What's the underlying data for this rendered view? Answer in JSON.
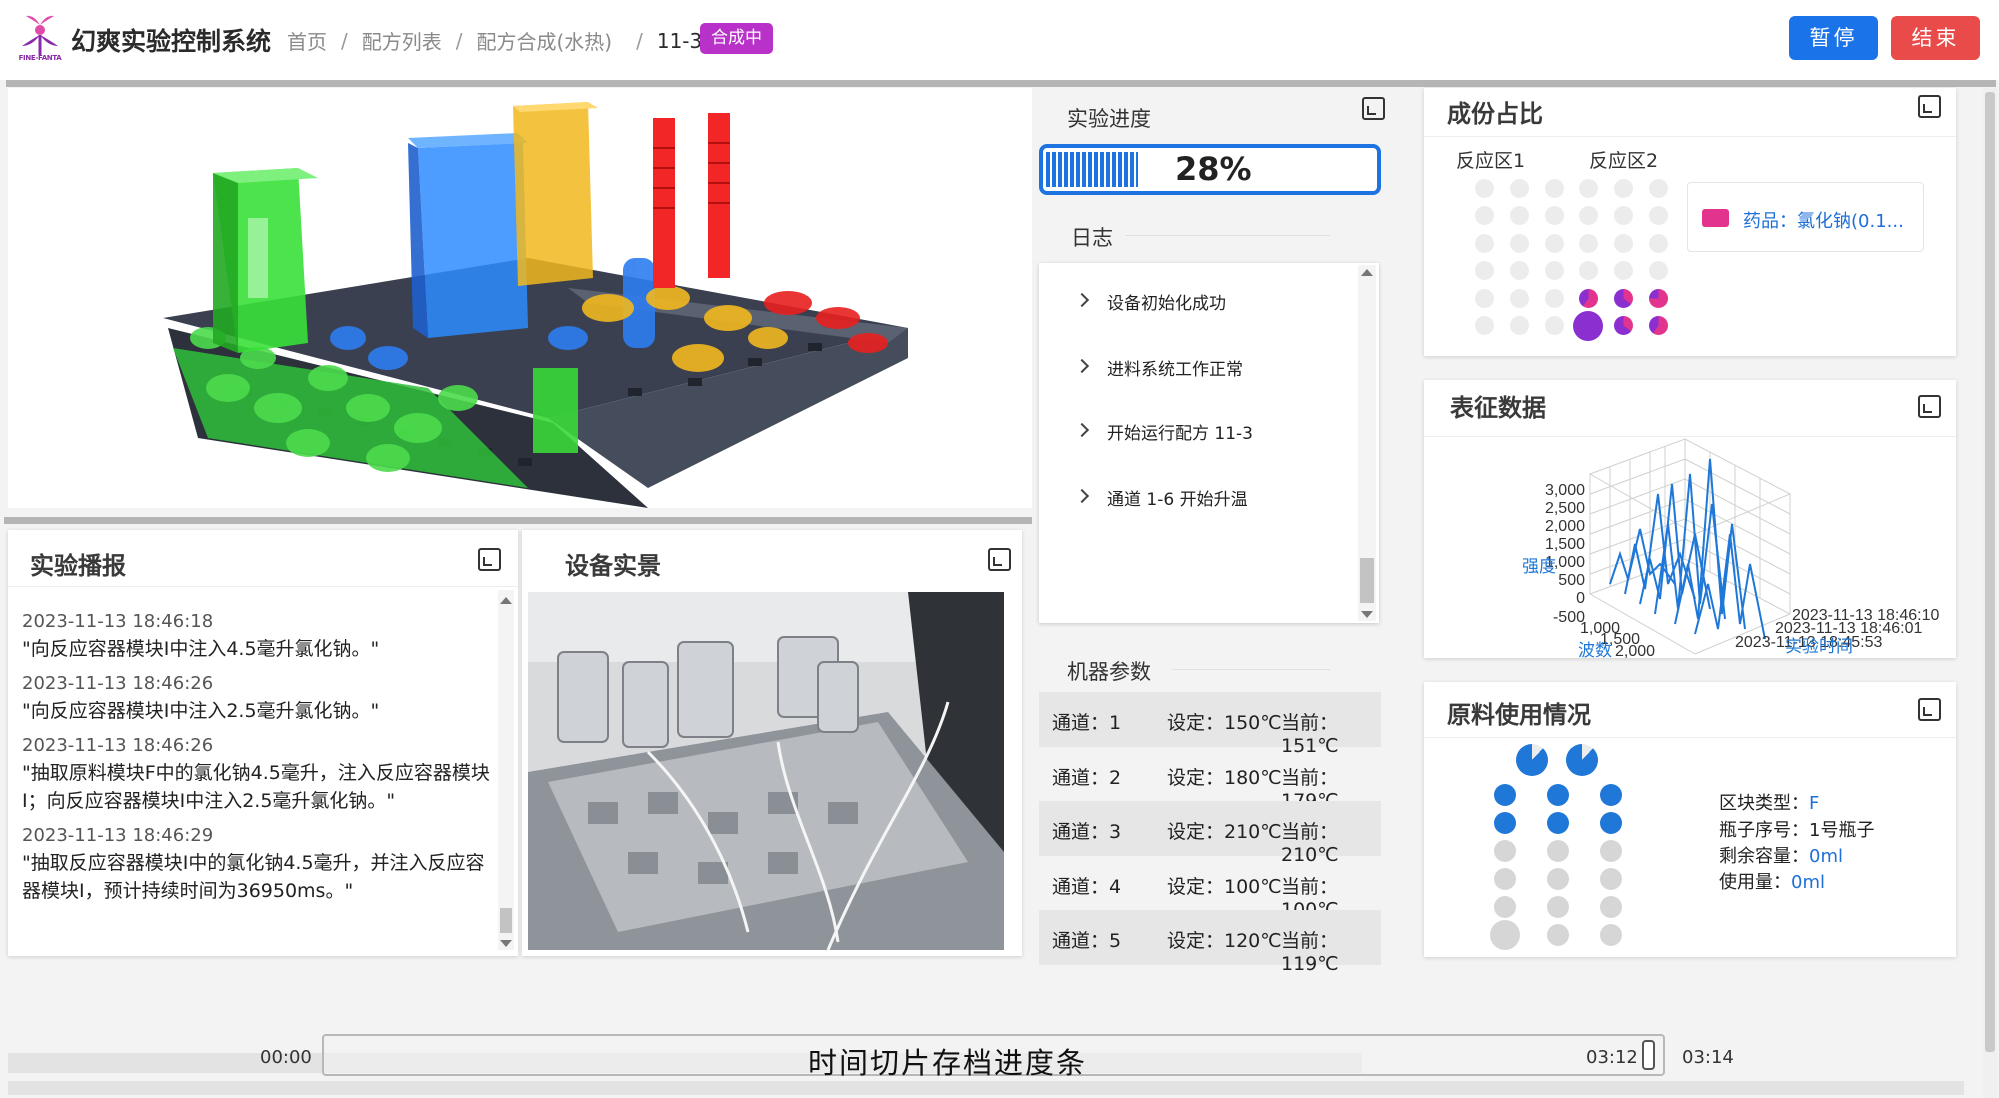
{
  "header": {
    "app_title": "幻爽实验控制系统",
    "logo_text": "FINE-FANTA",
    "breadcrumb": [
      "首页",
      "配方列表",
      "配方合成(水热)",
      "11-3"
    ],
    "status_badge": "合成中",
    "pause_label": "暂停",
    "end_label": "结束"
  },
  "colors": {
    "primary": "#1a73e8",
    "danger": "#e94b4b",
    "badge": "#b832c9",
    "reagent": "#e2338e",
    "dot_purple": "#8b2fd0",
    "link_blue": "#1f6fd8"
  },
  "broadcast": {
    "title": "实验播报",
    "items": [
      {
        "time": "2023-11-13 18:46:18",
        "msg": "\"向反应容器模块I中注入4.5毫升氯化钠。\""
      },
      {
        "time": "2023-11-13 18:46:26",
        "msg": "\"向反应容器模块I中注入2.5毫升氯化钠。\""
      },
      {
        "time": "2023-11-13 18:46:26",
        "msg": "\"抽取原料模块F中的氯化钠4.5毫升，注入反应容器模块I；向反应容器模块I中注入2.5毫升氯化钠。\""
      },
      {
        "time": "2023-11-13 18:46:29",
        "msg": "\"抽取反应容器模块I中的氯化钠4.5毫升，并注入反应容器模块I，预计持续时间为36950ms。\""
      }
    ]
  },
  "equipment": {
    "title": "设备实景"
  },
  "progress": {
    "title": "实验进度",
    "percent_label": "28%",
    "percent": 28
  },
  "log": {
    "title": "日志",
    "items": [
      "设备初始化成功",
      "进料系统工作正常",
      "开始运行配方 11-3",
      "通道 1-6 开始升温"
    ]
  },
  "params": {
    "title": "机器参数",
    "rows": [
      {
        "channel": "通道：1",
        "set": "设定：150℃",
        "cur": "当前：151℃"
      },
      {
        "channel": "通道：2",
        "set": "设定：180℃",
        "cur": "当前：179℃"
      },
      {
        "channel": "通道：3",
        "set": "设定：210℃",
        "cur": "当前：210℃"
      },
      {
        "channel": "通道：4",
        "set": "设定：100℃",
        "cur": "当前：100℃"
      },
      {
        "channel": "通道：5",
        "set": "设定：120℃",
        "cur": "当前：119℃"
      }
    ]
  },
  "composition": {
    "title": "成份占比",
    "zone1": "反应区1",
    "zone2": "反应区2",
    "legend": "药品：氯化钠(0.1..."
  },
  "characterization": {
    "title": "表征数据",
    "y_label": "强度",
    "x_label": "波数",
    "z_label": "实验时间",
    "y_ticks": [
      "3,000",
      "2,500",
      "2,000",
      "1,500",
      "1,000",
      "500",
      "0",
      "-500"
    ],
    "x_ticks": [
      "1,000",
      "1,500",
      "2,000"
    ],
    "z_ticks": [
      "2023-11-13 18:46:10",
      "2023-11-13 18:46:01",
      "2023-11-13 18:45:53"
    ]
  },
  "materials": {
    "title": "原料使用情况",
    "block_type_label": "区块类型：",
    "block_type_value": "F",
    "bottle_label": "瓶子序号：",
    "bottle_value": "1号瓶子",
    "remain_label": "剩余容量：",
    "remain_value": "0ml",
    "used_label": "使用量：",
    "used_value": "0ml"
  },
  "timeline": {
    "caption": "时间切片存档进度条",
    "start": "00:00",
    "current": "03:12",
    "end": "03:14"
  }
}
